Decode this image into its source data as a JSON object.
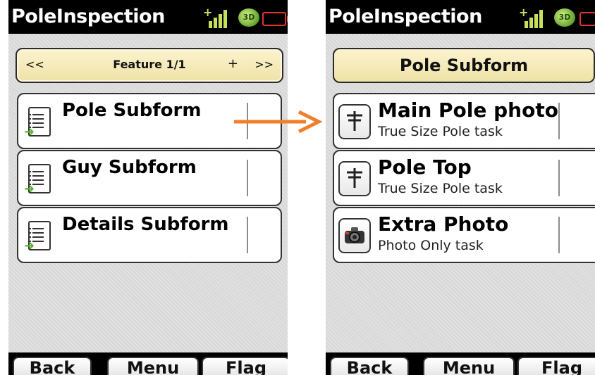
{
  "app_title": "PoleInspection",
  "status": {
    "badge_3d": "3D"
  },
  "left_screen": {
    "nav": {
      "prev": "<<",
      "feature": "Feature 1/1",
      "add": "+",
      "next": ">>"
    },
    "items": [
      {
        "title": "Pole Subform",
        "icon": "form-icon"
      },
      {
        "title": "Guy Subform",
        "icon": "form-icon"
      },
      {
        "title": "Details Subform",
        "icon": "form-icon"
      }
    ]
  },
  "right_screen": {
    "header": "Pole Subform",
    "items": [
      {
        "title": "Main Pole photo",
        "subtitle": "True Size Pole task",
        "icon": "pole-icon"
      },
      {
        "title": "Pole Top",
        "subtitle": "True Size Pole task",
        "icon": "pole-icon"
      },
      {
        "title": "Extra Photo",
        "subtitle": "Photo Only task",
        "icon": "camera-icon"
      }
    ]
  },
  "softkeys": {
    "back": "Back",
    "menu": "Menu",
    "flag": "Flag"
  },
  "colors": {
    "arrow": "#f07f2c",
    "header_fill": "#f3e8b3",
    "signal": "#c6e05a",
    "battery": "#e0362c",
    "form_arrow": "#58b52e"
  }
}
